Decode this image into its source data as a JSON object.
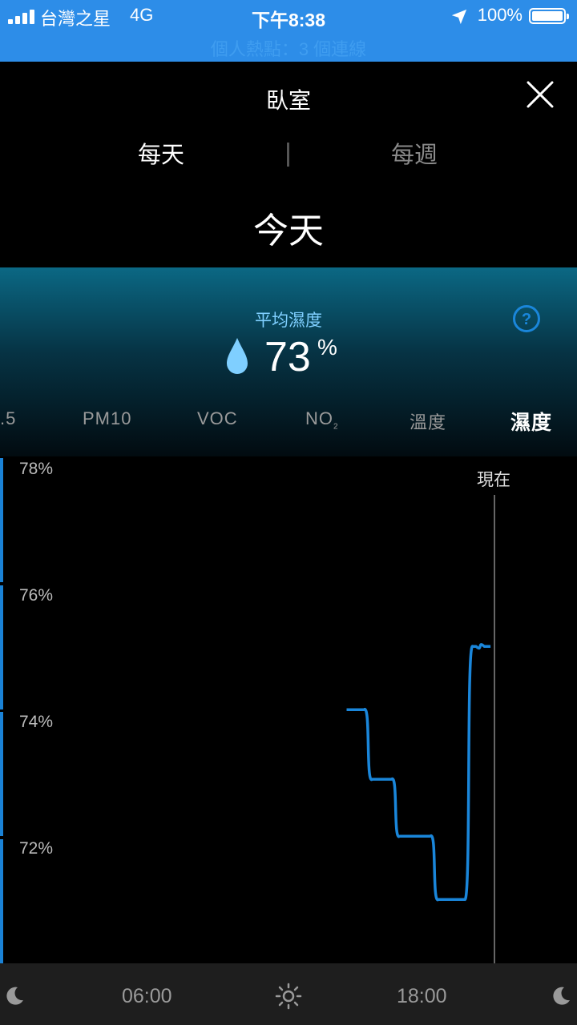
{
  "status_bar": {
    "carrier": "台灣之星",
    "network": "4G",
    "time": "下午8:38",
    "battery": "100%",
    "banner": "個人熱點：3 個連線"
  },
  "header": {
    "title": "臥室",
    "tabs": [
      "每天",
      "每週"
    ],
    "active_tab": "每天",
    "date": "今天"
  },
  "summary": {
    "label": "平均濕度",
    "value": "73",
    "unit": "%",
    "accent": "#7fcfff"
  },
  "metrics": {
    "pm25": ".5",
    "pm10": "PM10",
    "voc": "VOC",
    "no2": "NO",
    "no2_sub": "2",
    "temp": "溫度",
    "humidity": "濕度",
    "active": "濕度"
  },
  "chart_data": {
    "type": "line",
    "ylabel": "",
    "y_ticks": [
      "78%",
      "76%",
      "74%",
      "72%"
    ],
    "ylim": [
      70,
      78
    ],
    "x_ticks": [
      "06:00",
      "18:00"
    ],
    "now_label": "現在",
    "line_color": "#1a86da",
    "series": [
      {
        "values": [
          {
            "t": 15.0,
            "y": 74.2
          },
          {
            "t": 15.7,
            "y": 73.1
          },
          {
            "t": 16.9,
            "y": 72.2
          },
          {
            "t": 18.6,
            "y": 71.2
          },
          {
            "t": 20.1,
            "y": 75.2
          },
          {
            "t": 20.6,
            "y": 75.2
          }
        ]
      }
    ]
  },
  "bottom_axis": {
    "left_label": "06:00",
    "right_label": "18:00",
    "icons": [
      "moon-icon",
      "sun-icon",
      "moon-icon"
    ]
  }
}
